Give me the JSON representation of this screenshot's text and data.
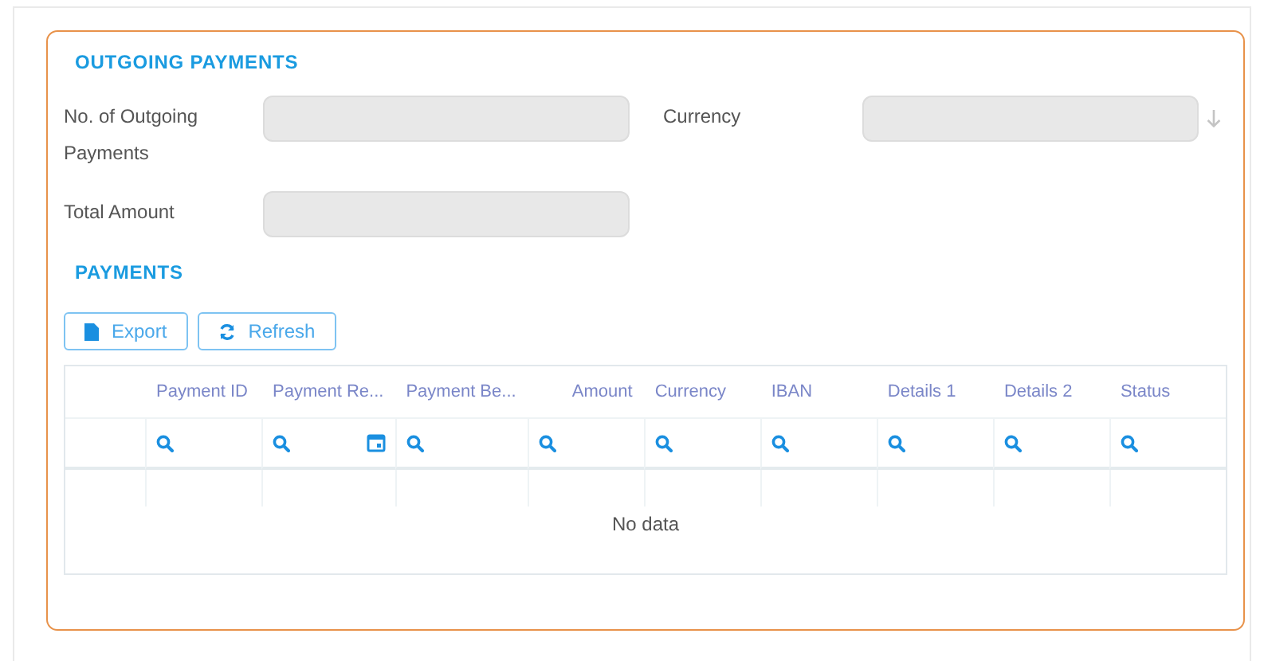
{
  "section_title": "OUTGOING PAYMENTS",
  "fields": [
    {
      "label": "No. of Outgoing Payments",
      "kind": "input"
    },
    {
      "label": "Currency",
      "kind": "dropdown"
    },
    {
      "label": "Total Amount",
      "kind": "input"
    }
  ],
  "payments": {
    "title": "PAYMENTS",
    "buttons": [
      {
        "label": "Export",
        "kind": "export"
      },
      {
        "label": "Refresh",
        "kind": "refresh"
      }
    ],
    "columns": [
      {
        "label": "Payment ID",
        "kind": "text"
      },
      {
        "label": "Payment Re...",
        "kind": "date"
      },
      {
        "label": "Payment Be...",
        "kind": "text"
      },
      {
        "label": "Amount",
        "kind": "number"
      },
      {
        "label": "Currency",
        "kind": "text"
      },
      {
        "label": "IBAN",
        "kind": "text"
      },
      {
        "label": "Details 1",
        "kind": "text"
      },
      {
        "label": "Details 2",
        "kind": "text"
      },
      {
        "label": "Status",
        "kind": "text"
      }
    ],
    "empty_text": "No data"
  }
}
